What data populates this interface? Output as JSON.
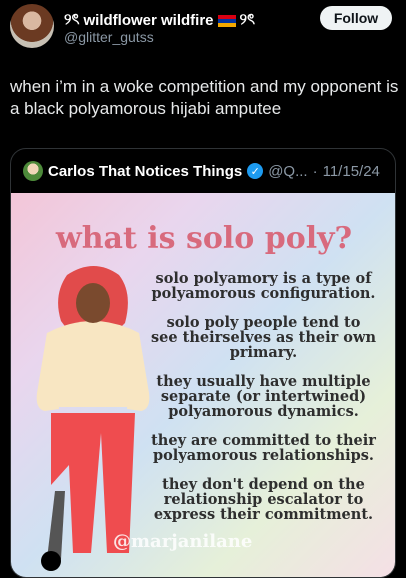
{
  "tweet": {
    "display_name_left_emoji": "୨ৎ",
    "display_name": "wildflower wildfire",
    "display_name_right_emoji": "୨ৎ",
    "handle": "@glitter_gutss",
    "follow_label": "Follow",
    "text": "when i’m in a woke competition and my opponent is a black polyamorous hijabi amputee"
  },
  "quoted": {
    "name": "Carlos That Notices Things",
    "handle": "@Q...",
    "separator": "·",
    "date": "11/15/24",
    "image": {
      "title": "what is solo poly?",
      "lines": [
        "solo polyamory is a type of polyamorous configuration.",
        "solo poly people tend to see theirselves as their own primary.",
        "they usually have multiple separate (or intertwined) polyamorous dynamics.",
        "they are committed to their polyamorous relationships.",
        "they don't depend on the relationship escalator to express their commitment."
      ],
      "watermark": "@marjanilane"
    }
  }
}
